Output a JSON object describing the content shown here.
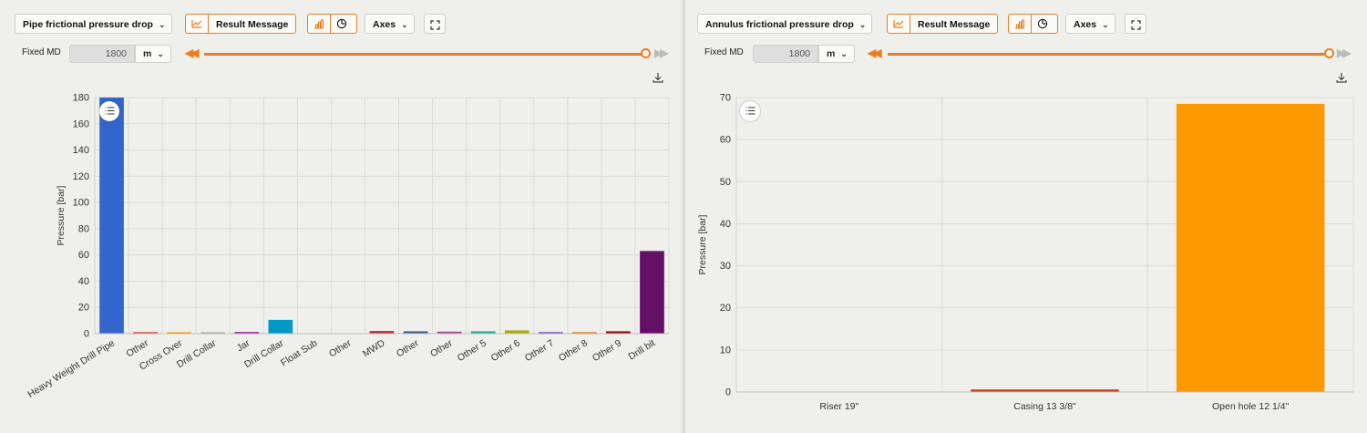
{
  "left": {
    "dropdown_label": "Pipe frictional pressure drop",
    "result_label": "Result Message",
    "axes_label": "Axes",
    "fixed_md_label": "Fixed MD",
    "fixed_md_value": "1800",
    "unit_value": "m",
    "slider_fraction": 1.0,
    "icons": {
      "chevron": "chevron-down-icon",
      "result": "chart-line-icon",
      "bar": "bar-chart-icon",
      "pie": "pie-chart-icon",
      "expand": "expand-icon",
      "rewind": "rewind-icon",
      "forward": "fast-forward-icon",
      "download": "download-icon",
      "menu": "menu-icon"
    }
  },
  "right": {
    "dropdown_label": "Annulus frictional pressure drop",
    "result_label": "Result Message",
    "axes_label": "Axes",
    "fixed_md_label": "Fixed MD",
    "fixed_md_value": "1800",
    "unit_value": "m",
    "slider_fraction": 1.0
  },
  "accent_color": "#f07d1c",
  "chart_data": [
    {
      "type": "bar",
      "ylabel": "Pressure [bar]",
      "xlabel": "",
      "ylim": [
        0,
        180
      ],
      "yticks": [
        0,
        20,
        40,
        60,
        80,
        100,
        120,
        140,
        160,
        180
      ],
      "grid": true,
      "categories": [
        "Heavy Weight Drill Pipe",
        "Other",
        "Cross Over",
        "Drill Collar",
        "Jar",
        "Drill Collar",
        "Float Sub",
        "Other",
        "MWD",
        "Other",
        "Other",
        "Other 5",
        "Other 6",
        "Other 7",
        "Other 8",
        "Other 9",
        "Drill bit"
      ],
      "values": [
        180,
        0.8,
        0.3,
        0.4,
        1.2,
        10.5,
        0,
        0,
        2.0,
        1.8,
        1.5,
        1.8,
        2.5,
        0.8,
        0.4,
        1.8,
        63
      ],
      "colors": [
        "#3366cc",
        "#dc3912",
        "#ff9900",
        "#aaaaaa",
        "#990099",
        "#0099c6",
        "#dd4477",
        "#66aa00",
        "#b82e2e",
        "#316395",
        "#994499",
        "#22aa99",
        "#aaaa11",
        "#6633cc",
        "#e67300",
        "#8b0707",
        "#651067"
      ]
    },
    {
      "type": "bar",
      "ylabel": "Pressure [bar]",
      "xlabel": "",
      "ylim": [
        0,
        70
      ],
      "yticks": [
        0,
        10,
        20,
        30,
        40,
        50,
        60,
        70
      ],
      "grid": true,
      "categories": [
        "Riser 19\"",
        "Casing 13 3/8\"",
        "Open hole 12 1/4\""
      ],
      "values": [
        0,
        0.6,
        68.5
      ],
      "colors": [
        "#3366cc",
        "#dc3912",
        "#ff9900"
      ]
    }
  ]
}
